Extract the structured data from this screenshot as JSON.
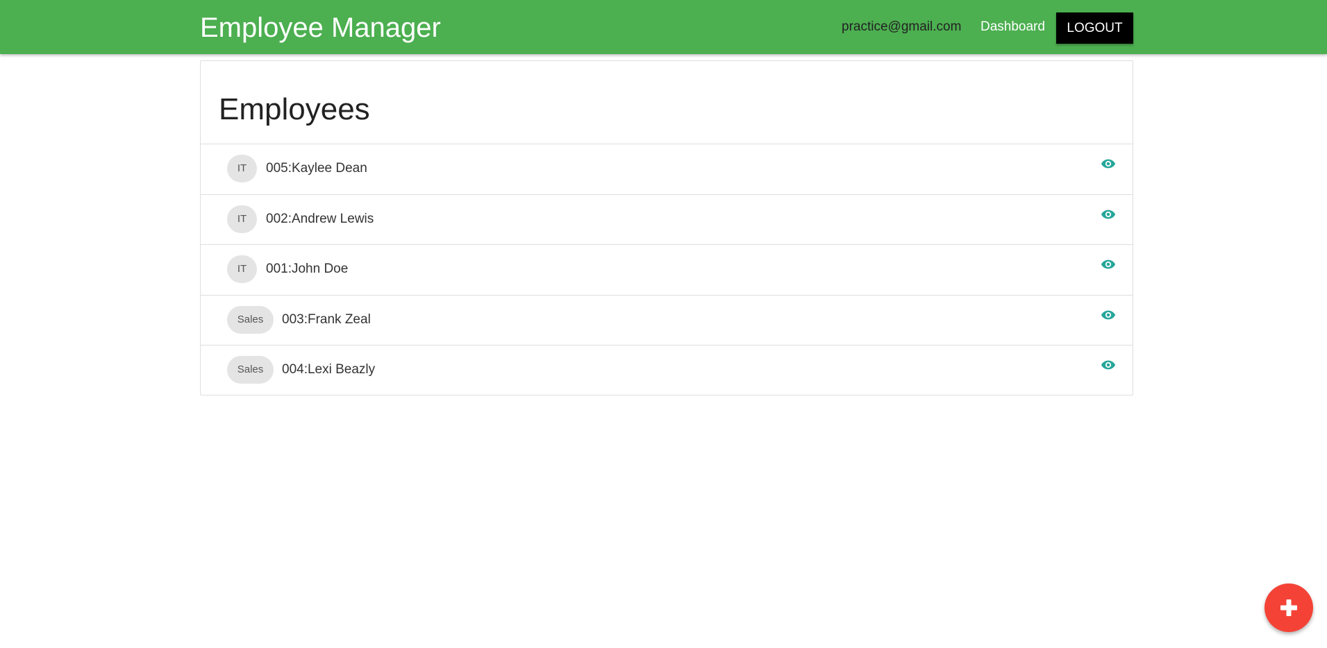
{
  "header": {
    "brand": "Employee Manager",
    "email": "practice@gmail.com",
    "dashboard_label": "Dashboard",
    "logout_label": "LOGOUT",
    "background_color": "#4caf50"
  },
  "main": {
    "title": "Employees",
    "employees": [
      {
        "department": "IT",
        "label": "005:Kaylee Dean"
      },
      {
        "department": "IT",
        "label": "002:Andrew Lewis"
      },
      {
        "department": "IT",
        "label": "001:John Doe"
      },
      {
        "department": "Sales",
        "label": "003:Frank Zeal"
      },
      {
        "department": "Sales",
        "label": "004:Lexi Beazly"
      }
    ],
    "row_icon": "eye-icon",
    "row_icon_color": "#26a69a"
  },
  "fab": {
    "icon": "plus-icon",
    "color": "#f44336"
  }
}
